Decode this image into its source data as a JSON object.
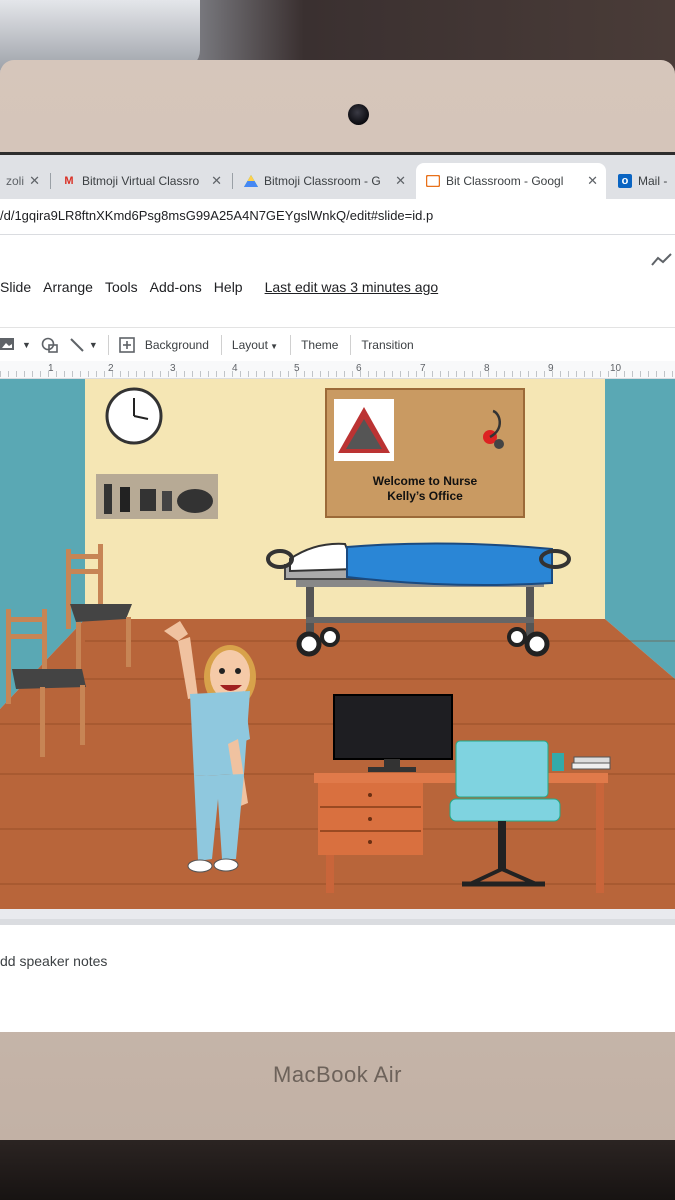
{
  "device": {
    "brand": "MacBook Air"
  },
  "tabs": [
    {
      "label": "zoli",
      "icon": "doc-icon",
      "active": false
    },
    {
      "label": "Bitmoji Virtual Classro",
      "icon": "gmail-icon",
      "active": false
    },
    {
      "label": "Bitmoji Classroom - G",
      "icon": "drive-icon",
      "active": false
    },
    {
      "label": "Bit Classroom - Googl",
      "icon": "slides-icon",
      "active": true
    },
    {
      "label": "Mail -",
      "icon": "outlook-icon",
      "active": false
    }
  ],
  "address": {
    "url": "/d/1gqira9LR8ftnXKmd6Psg8msG99A25A4N7GEYgslWnkQ/edit#slide=id.p"
  },
  "menu": {
    "items": [
      "Slide",
      "Arrange",
      "Tools",
      "Add-ons",
      "Help"
    ],
    "last_edit": "Last edit was 3 minutes ago"
  },
  "toolbar": {
    "background": "Background",
    "layout": "Layout",
    "theme": "Theme",
    "transition": "Transition"
  },
  "ruler": {
    "numbers": [
      "1",
      "2",
      "3",
      "4",
      "5",
      "6",
      "7",
      "8",
      "9",
      "10"
    ]
  },
  "slide": {
    "board_text_line1": "Welcome to Nurse",
    "board_text_line2": "Kelly’s Office",
    "colors": {
      "wall": "#f5e6b4",
      "side_wall": "#5aa8b4",
      "floor": "#b8653a",
      "board": "#c99a62",
      "bed_blanket": "#2a86d6",
      "chair_seat": "#7fd3e0"
    }
  },
  "notes": {
    "placeholder": "dd speaker notes"
  }
}
